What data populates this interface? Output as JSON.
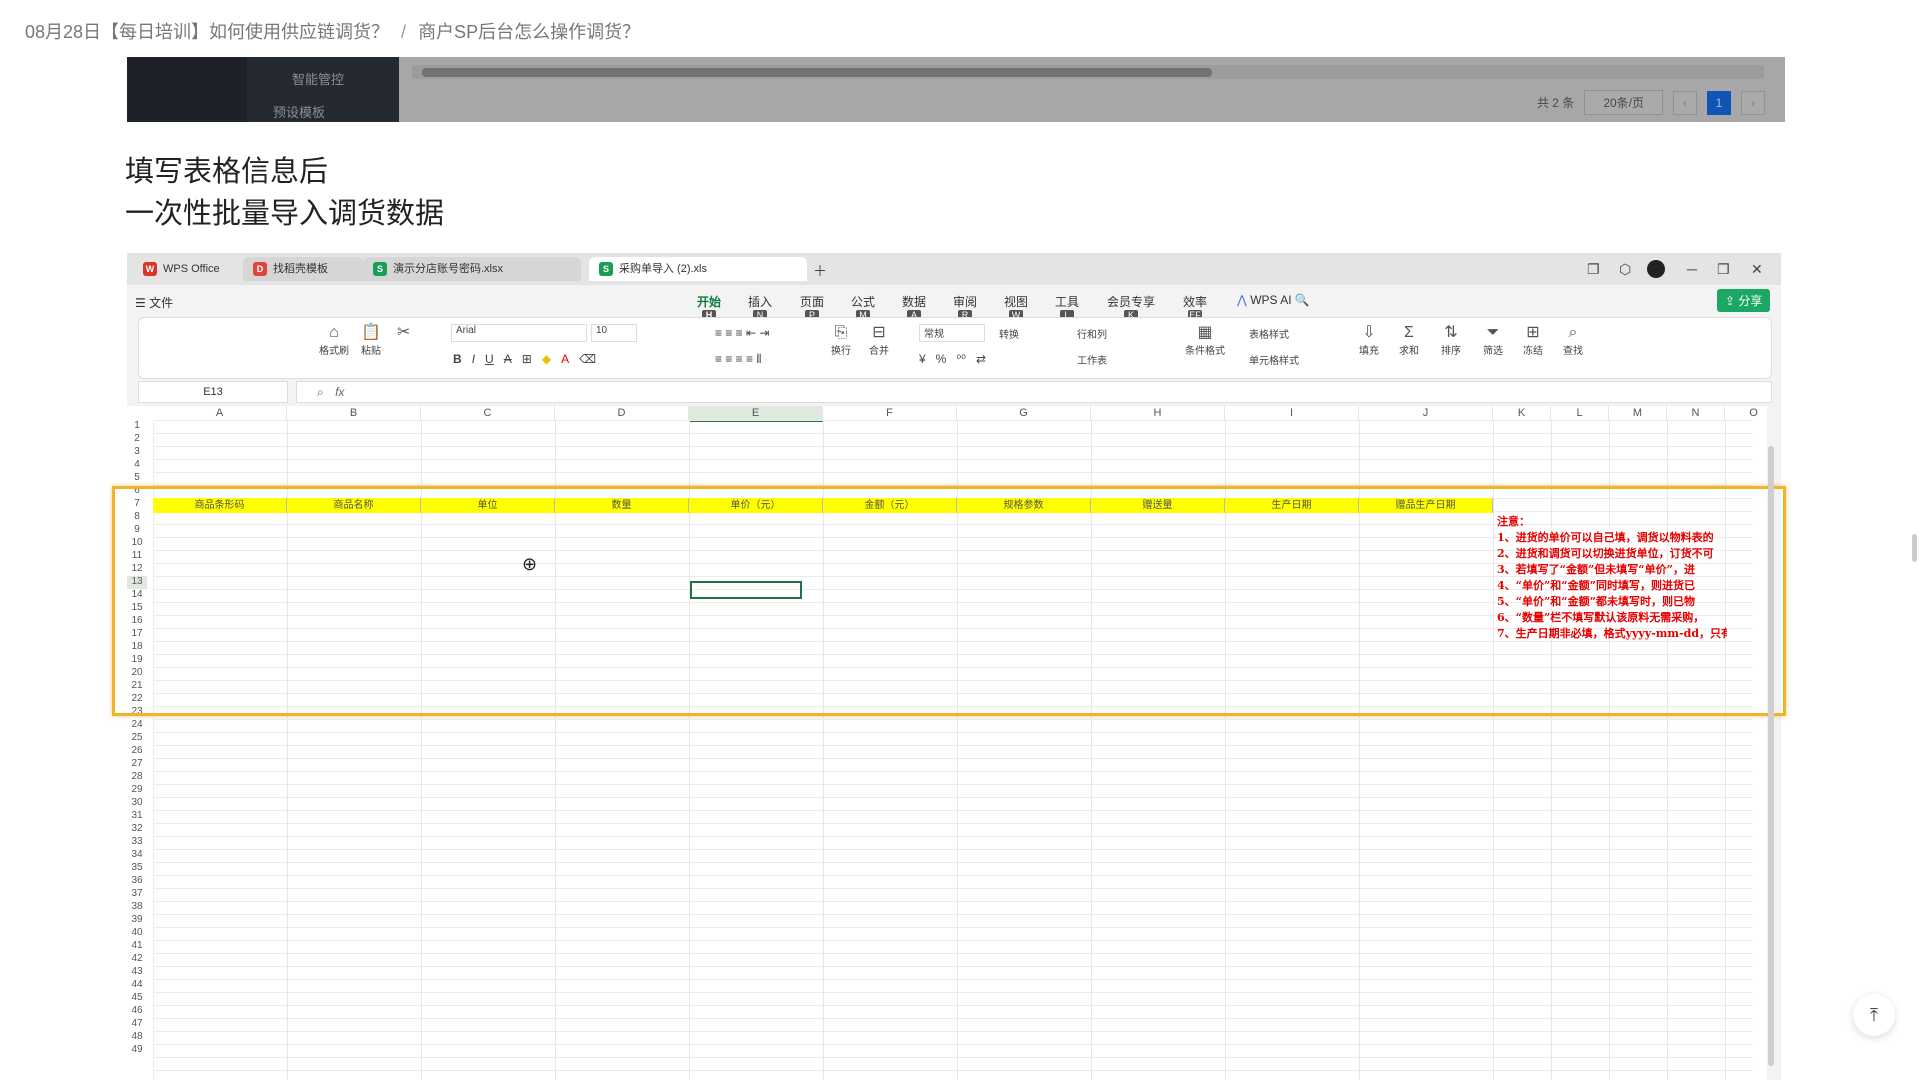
{
  "breadcrumb": {
    "parent": "08月28日【每日培训】如何使用供应链调货？",
    "separator": "/",
    "current": "商户SP后台怎么操作调货？"
  },
  "top_screenshot": {
    "menu_item_1": "智能管控",
    "menu_item_2": "预设模板",
    "total": "共 2 条",
    "page_size": "20条/页",
    "prev": "‹",
    "page": "1",
    "next": "›"
  },
  "caption": {
    "line1": "填写表格信息后",
    "line2": "一次性批量导入调货数据"
  },
  "wps": {
    "tabs": [
      {
        "label": "WPS Office",
        "icon": "W"
      },
      {
        "label": "找稻壳模板",
        "icon": "D"
      },
      {
        "label": "演示分店账号密码.xlsx",
        "icon": "S"
      },
      {
        "label": "采购单导入 (2).xls",
        "icon": "S"
      }
    ],
    "menus": [
      {
        "label": "开始",
        "key": "H"
      },
      {
        "label": "插入",
        "key": "N"
      },
      {
        "label": "页面",
        "key": "P"
      },
      {
        "label": "公式",
        "key": "M"
      },
      {
        "label": "数据",
        "key": "A"
      },
      {
        "label": "审阅",
        "key": "R"
      },
      {
        "label": "视图",
        "key": "W"
      },
      {
        "label": "工具",
        "key": "L"
      },
      {
        "label": "会员专享",
        "key": "K"
      },
      {
        "label": "效率",
        "key": "EF"
      }
    ],
    "file_menu": "文件",
    "wps_ai": "WPS AI",
    "share": "分享",
    "ribbon": {
      "format_painter": "格式刷",
      "paste": "粘贴",
      "font": "Arial",
      "size": "10",
      "wrap": "换行",
      "merge": "合并",
      "number_format": "常规",
      "convert": "转换",
      "rows_cols": "行和列",
      "worksheet": "工作表",
      "table_style": "表格样式",
      "cond_format": "条件格式",
      "cell_style": "单元格样式",
      "fill": "填充",
      "sum": "求和",
      "sort": "排序",
      "filter": "筛选",
      "freeze": "冻结",
      "find": "查找"
    },
    "name_box": "E13",
    "fx": "fx",
    "columns": [
      "A",
      "B",
      "C",
      "D",
      "E",
      "F",
      "G",
      "H",
      "I",
      "J",
      "K",
      "L",
      "M",
      "N",
      "O"
    ],
    "rows": [
      "1",
      "2",
      "3",
      "4",
      "5",
      "6",
      "7",
      "8",
      "9",
      "10",
      "11",
      "12",
      "13",
      "14",
      "15",
      "16",
      "17",
      "18",
      "19",
      "20",
      "21",
      "22",
      "23",
      "24",
      "25",
      "26",
      "27",
      "28",
      "29",
      "30",
      "31",
      "32",
      "33",
      "34",
      "35",
      "36",
      "37",
      "38",
      "39",
      "40",
      "41",
      "42",
      "43",
      "44",
      "45",
      "46",
      "47",
      "48",
      "49"
    ],
    "header_row": [
      "商品条形码",
      "商品名称",
      "单位",
      "数量",
      "单价（元）",
      "金额（元）",
      "规格参数",
      "赠送量",
      "生产日期",
      "赠品生产日期"
    ],
    "notes": [
      "注意：",
      "1、进货的单价可以自己填，调货以物料表的",
      "2、进货和调货可以切换进货单位，订货不可",
      "3、若填写了“金额”但未填写“单价”，进",
      "4、“单价”和“金额”同时填写，则进货已",
      "5、“单价”和“金额”都未填写时，则已物",
      "6、“数量”栏不填写默认该原料无需采购，",
      "7、生产日期非必填，格式yyyy-mm-dd，只有"
    ]
  },
  "back_to_top": "⤒",
  "colors": {
    "header_yellow": "#ffff00",
    "highlight_border": "#f0b429",
    "notes_red": "#e60000",
    "wps_green": "#0f7b3f"
  }
}
